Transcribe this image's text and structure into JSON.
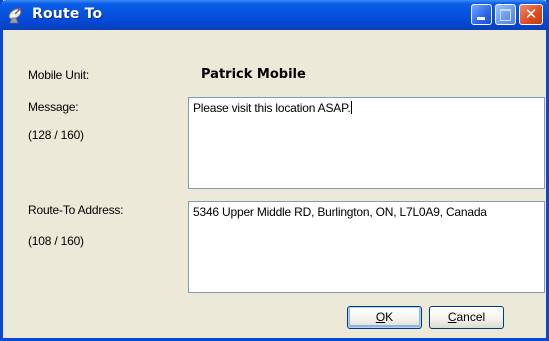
{
  "window": {
    "title": "Route To",
    "icon": "satellite-dish-icon",
    "controls": {
      "minimize": "minimize-icon",
      "maximize": "maximize-icon",
      "close": "close-icon"
    }
  },
  "form": {
    "mobile_unit_label": "Mobile Unit:",
    "mobile_unit_value": "Patrick Mobile",
    "message_label": "Message:",
    "message_count": "(128 / 160)",
    "message_value": "Please visit this location ASAP.",
    "address_label": "Route-To Address:",
    "address_count": "(108 / 160)",
    "address_value": "5346 Upper Middle RD, Burlington, ON, L7L0A9, Canada"
  },
  "buttons": {
    "ok_mnemonic": "O",
    "ok_rest": "K",
    "cancel_mnemonic": "C",
    "cancel_rest": "ancel"
  },
  "colors": {
    "titlebar": "#0553e0",
    "window_bg": "#ece9d8",
    "textbox_border": "#7f9db9",
    "button_border": "#003c74"
  }
}
